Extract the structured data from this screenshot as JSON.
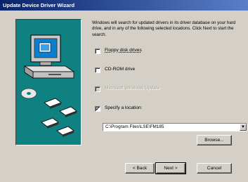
{
  "window": {
    "title": "Update Device Driver Wizard"
  },
  "intro_text": "Windows will search for updated drivers in its driver database on your hard drive, and in any of the following selected locations. Click Next to start the search.",
  "options": [
    {
      "label": "Floppy disk drives",
      "checked": false,
      "enabled": true
    },
    {
      "label": "CD-ROM drive",
      "checked": false,
      "enabled": true
    },
    {
      "label": "Microsoft Windows Update",
      "checked": false,
      "enabled": false
    },
    {
      "label": "Specify a location:",
      "checked": true,
      "enabled": true
    }
  ],
  "location": {
    "value": "C:\\Program Files\\LSE\\FM185"
  },
  "buttons": {
    "browse": "Browse...",
    "back": "< Back",
    "next": "Next >",
    "cancel": "Cancel"
  },
  "glyphs": {
    "check": "✓",
    "dropdown": "▼"
  },
  "colors": {
    "titlebar": "#08246b",
    "art_background": "#0f8181",
    "dialog": "#d4d0c8"
  }
}
